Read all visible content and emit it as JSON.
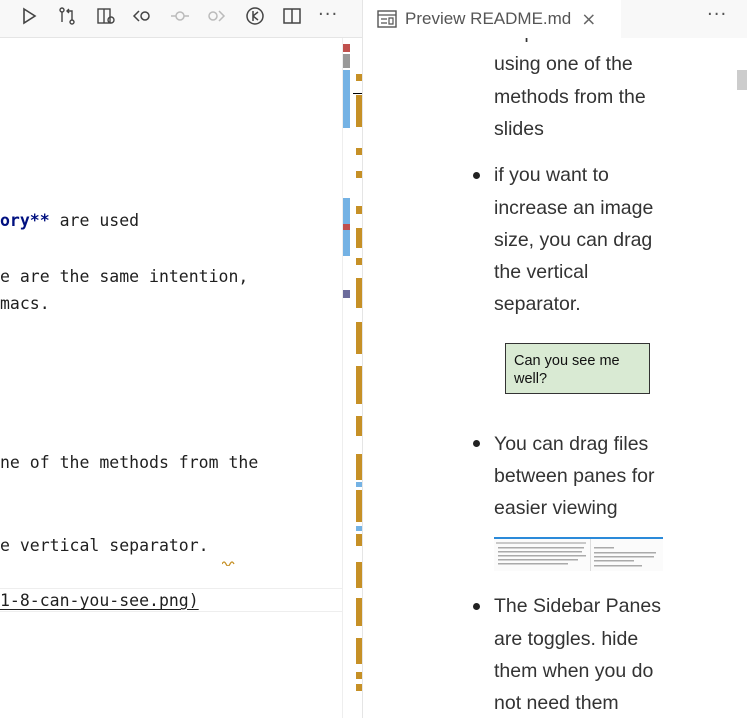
{
  "toolbar": {
    "icons": [
      "run-icon",
      "compare-changes-icon",
      "open-preview-icon",
      "go-back-icon",
      "commit-icon",
      "go-forward-icon",
      "timeline-icon",
      "split-editor-icon"
    ],
    "more_label": "···"
  },
  "editor": {
    "lines": [
      {
        "pre": "",
        "bold": "ory**",
        "post": " are used"
      },
      {
        "pre": "e are the same intention,",
        "bold": "",
        "post": ""
      },
      {
        "pre": "macs.",
        "bold": "",
        "post": ""
      },
      {
        "pre": "ne of the methods from the",
        "bold": "",
        "post": ""
      },
      {
        "pre": "e vertical separator.",
        "bold": "",
        "post": ""
      },
      {
        "pre": "1-8-can-you-see.png)",
        "bold": "",
        "post": ""
      }
    ]
  },
  "preview_tab": {
    "label": "Preview README.md",
    "icon": "preview-icon",
    "close": "×",
    "more_label": "···"
  },
  "preview": {
    "cut_top_line": "in split screen",
    "item1_lines": [
      "using one of the",
      "methods from the",
      "slides"
    ],
    "item2_lines": [
      "if you want to",
      "increase an image",
      "size, you can drag",
      "the vertical",
      "separator."
    ],
    "image_text": "Can you see me well?",
    "item3_lines": [
      "You can drag files",
      "between panes for",
      "easier viewing"
    ],
    "item4_lines": [
      "The Sidebar Panes",
      "are toggles. hide",
      "them when you do",
      "not need them"
    ]
  },
  "colors": {
    "modified": "#c69026",
    "added": "#74b2e4",
    "bold_text": "#001080",
    "diagram_fill": "#d9ead3"
  }
}
